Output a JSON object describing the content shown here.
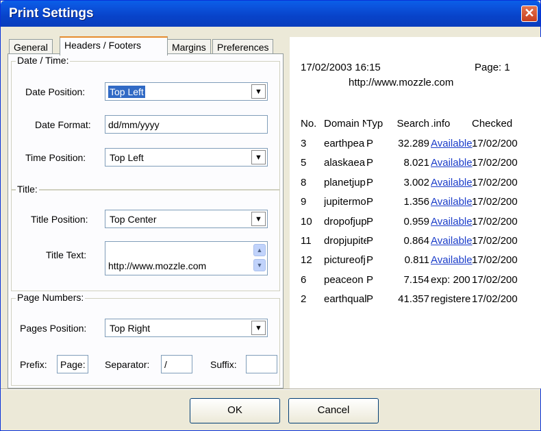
{
  "window": {
    "title": "Print Settings",
    "close_glyph": "✕"
  },
  "tabs": [
    "General",
    "Headers / Footers",
    "Margins",
    "Preferences"
  ],
  "date_time": {
    "legend": "Date / Time:",
    "date_position_label": "Date Position:",
    "date_position_value": "Top Left",
    "date_format_label": "Date Format:",
    "date_format_value": "dd/mm/yyyy",
    "time_position_label": "Time Position:",
    "time_position_value": "Top Left"
  },
  "title_group": {
    "legend": "Title:",
    "title_position_label": "Title Position:",
    "title_position_value": "Top Center",
    "title_text_label": "Title Text:",
    "title_text_value": "http://www.mozzle.com"
  },
  "page_numbers": {
    "legend": "Page Numbers:",
    "pages_position_label": "Pages Position:",
    "pages_position_value": "Top Right",
    "prefix_label": "Prefix:",
    "prefix_value": "Page:",
    "separator_label": "Separator:",
    "separator_value": "/",
    "suffix_label": "Suffix:",
    "suffix_value": ""
  },
  "preview": {
    "datetime": "17/02/2003 16:15",
    "page": "Page: 1",
    "title": "http://www.mozzle.com",
    "headers": [
      "No.",
      "Domain N",
      "Typ",
      "Search",
      ".info",
      "Checked"
    ],
    "rows": [
      [
        "3",
        "earthpea",
        "P",
        "32.289",
        "Available",
        "17/02/200"
      ],
      [
        "5",
        "alaskaea",
        "P",
        "8.021",
        "Available",
        "17/02/200"
      ],
      [
        "8",
        "planetjup",
        "P",
        "3.002",
        "Available",
        "17/02/200"
      ],
      [
        "9",
        "jupitermo",
        "P",
        "1.356",
        "Available",
        "17/02/200"
      ],
      [
        "10",
        "dropofjup",
        "P",
        "0.959",
        "Available",
        "17/02/200"
      ],
      [
        "11",
        "dropjupite",
        "P",
        "0.864",
        "Available",
        "17/02/200"
      ],
      [
        "12",
        "pictureofj",
        "P",
        "0.811",
        "Available",
        "17/02/200"
      ],
      [
        "6",
        "peaceon",
        "P",
        "7.154",
        "exp: 200",
        "17/02/200"
      ],
      [
        "2",
        "earthqual",
        "P",
        "41.357",
        "registere",
        "17/02/200"
      ]
    ]
  },
  "buttons": {
    "ok": "OK",
    "cancel": "Cancel"
  }
}
